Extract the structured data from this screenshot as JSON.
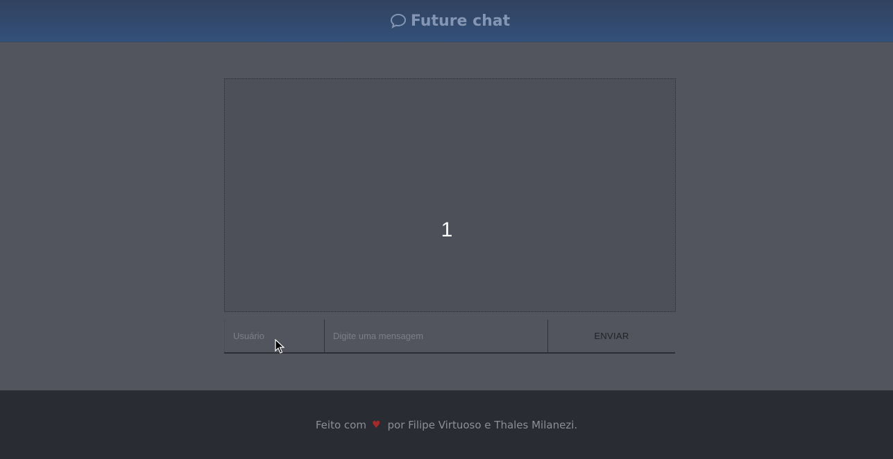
{
  "header": {
    "icon": "speech-bubble-icon",
    "title": "Future chat"
  },
  "chat": {
    "counter": "1"
  },
  "form": {
    "user_placeholder": "Usuário",
    "user_value": "",
    "message_placeholder": "Digite uma mensagem",
    "message_value": "",
    "send_label": "ENVIAR"
  },
  "footer": {
    "made_with": "Feito com",
    "heart_icon": "heart-icon",
    "by_text": "por Filipe Virtuoso e Thales Milanezi."
  },
  "colors": {
    "header_bg": "#33507a",
    "page_bg": "#52555e",
    "footer_bg": "#2a2c33",
    "heart": "#a52a2a"
  }
}
